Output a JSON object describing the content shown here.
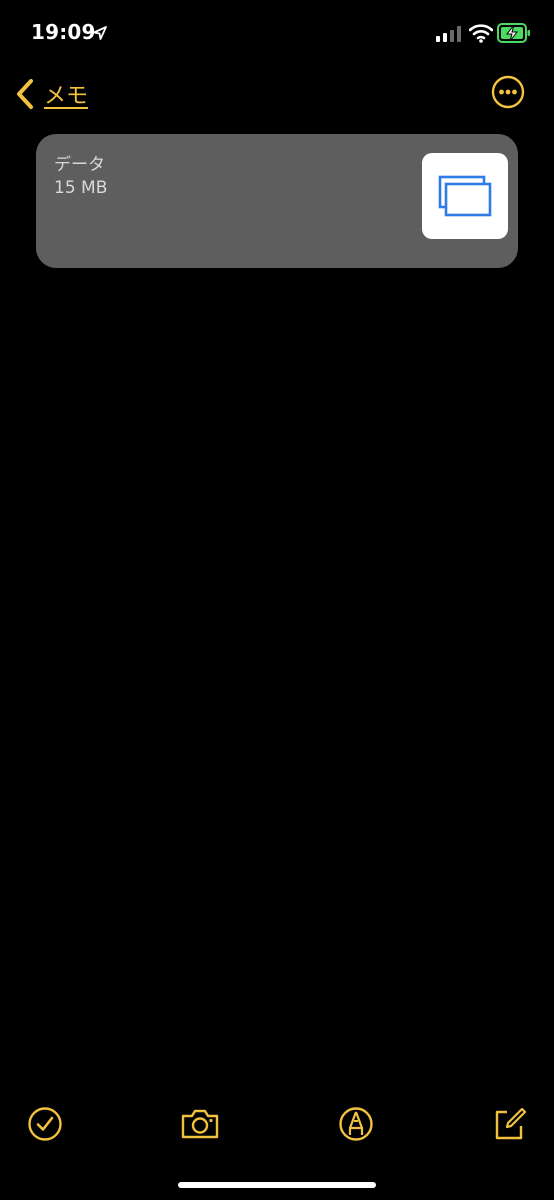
{
  "status_bar": {
    "time": "19:09",
    "icons": [
      "location-arrow-icon",
      "cellular-signal-icon",
      "wifi-icon",
      "battery-charging-icon"
    ]
  },
  "nav": {
    "back_label": "メモ",
    "back_icon": "chevron-left-icon",
    "more_icon": "ellipsis-circle-icon"
  },
  "attachment": {
    "name": "データ",
    "size": "15 MB",
    "thumbnail_icon": "stacked-windows-icon"
  },
  "toolbar": {
    "items": [
      "checklist-icon",
      "camera-icon",
      "markup-pen-icon",
      "compose-icon"
    ]
  },
  "colors": {
    "accent": "#F2C23E",
    "background": "#000000",
    "card": "#5E5E5E",
    "card_text": "#D9D9D9",
    "battery_green": "#4CD964",
    "thumb_icon": "#2F7BE8"
  }
}
